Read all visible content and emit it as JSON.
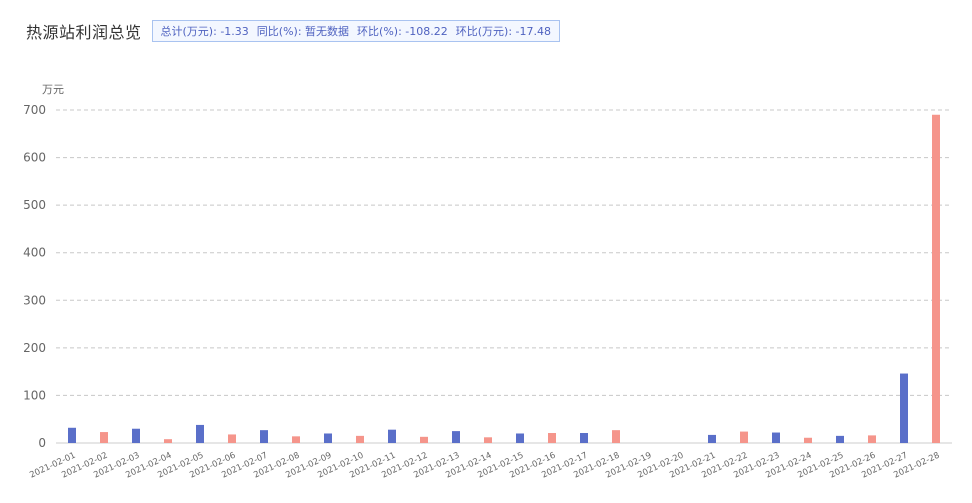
{
  "title": "热源站利润总览",
  "summary": [
    {
      "label": "总计(万元):",
      "value": "-1.33"
    },
    {
      "label": "同比(%):",
      "value": "暂无数据"
    },
    {
      "label": "环比(%):",
      "value": "-108.22"
    },
    {
      "label": "环比(万元):",
      "value": "-17.48"
    }
  ],
  "colors": {
    "odd_bar": "#5a6fc9",
    "even_bar": "#f5958b",
    "grid": "#c8c8c8",
    "axis_text": "#666666"
  },
  "chart_data": {
    "type": "bar",
    "ylabel": "万元",
    "xlabel": "",
    "title": "",
    "ylim": [
      0,
      700
    ],
    "yticks": [
      0,
      100,
      200,
      300,
      400,
      500,
      600,
      700
    ],
    "grid": true,
    "categories": [
      "2021-02-01",
      "2021-02-02",
      "2021-02-03",
      "2021-02-04",
      "2021-02-05",
      "2021-02-06",
      "2021-02-07",
      "2021-02-08",
      "2021-02-09",
      "2021-02-10",
      "2021-02-11",
      "2021-02-12",
      "2021-02-13",
      "2021-02-14",
      "2021-02-15",
      "2021-02-16",
      "2021-02-17",
      "2021-02-18",
      "2021-02-19",
      "2021-02-20",
      "2021-02-21",
      "2021-02-22",
      "2021-02-23",
      "2021-02-24",
      "2021-02-25",
      "2021-02-26",
      "2021-02-27",
      "2021-02-28"
    ],
    "values": [
      32,
      23,
      30,
      8,
      38,
      18,
      27,
      14,
      20,
      15,
      28,
      13,
      25,
      12,
      20,
      21,
      21,
      27,
      0,
      0,
      17,
      24,
      22,
      11,
      15,
      16,
      146,
      690
    ]
  }
}
